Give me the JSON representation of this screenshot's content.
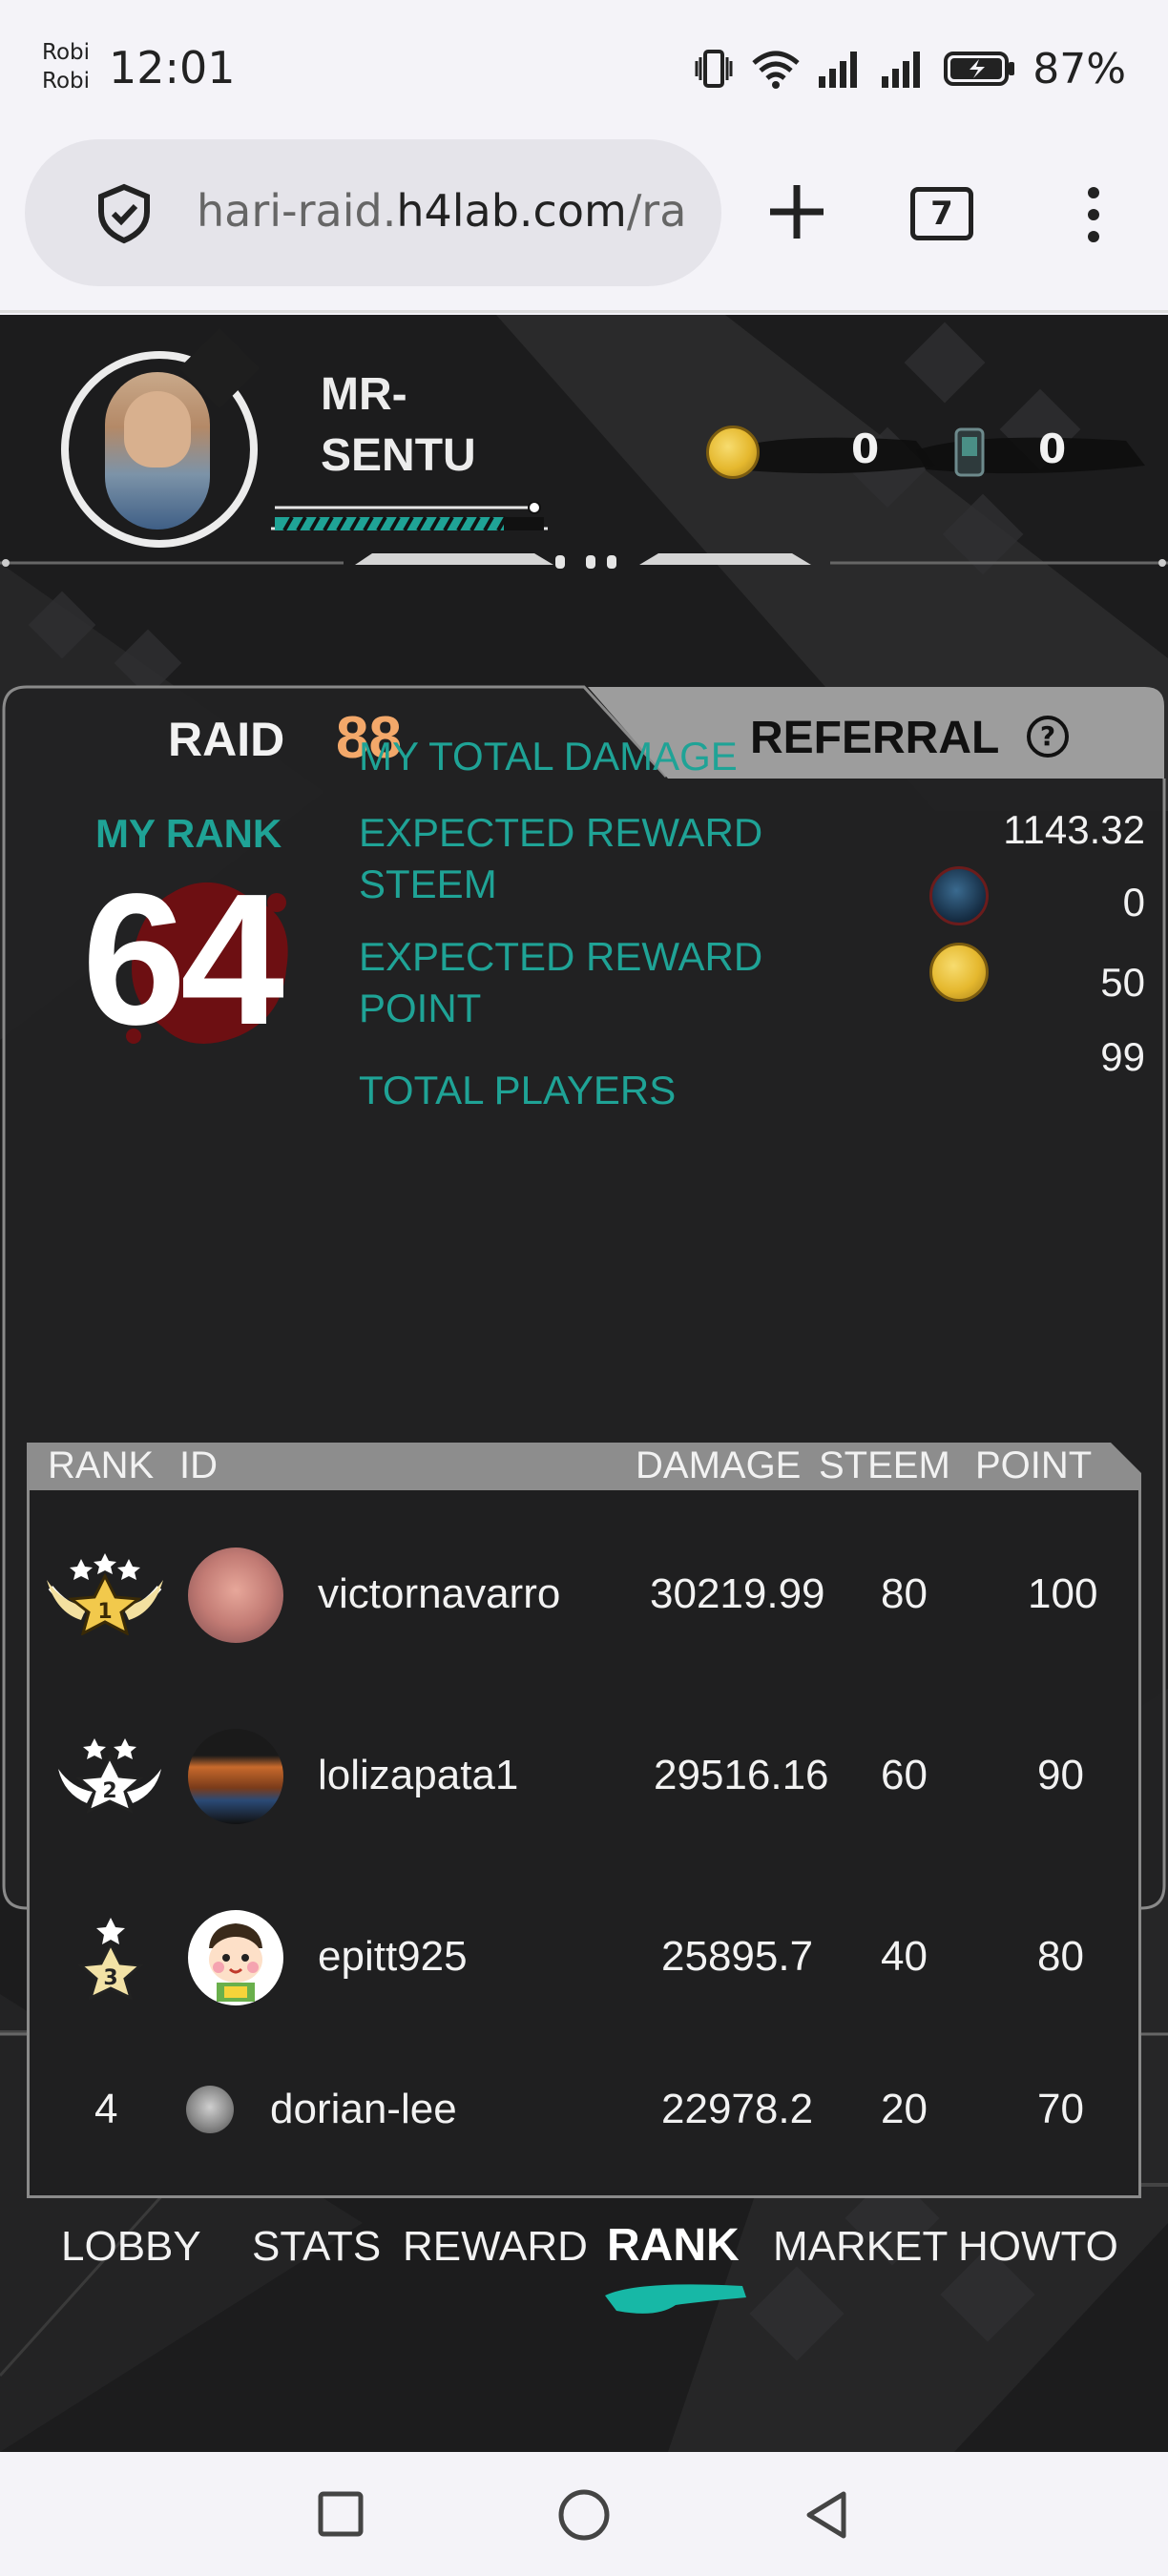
{
  "status_bar": {
    "carrier_1": "Robi",
    "carrier_2": "Robi",
    "time": "12:01",
    "battery": "87%"
  },
  "browser": {
    "url_prefix": "hari-raid.",
    "url_domain": "h4lab.com",
    "url_suffix": "/ra",
    "tab_count": "7"
  },
  "player": {
    "name": "MR-SENTU",
    "xp_progress": 0.85,
    "coin_value": "0",
    "item_value": "0"
  },
  "raid": {
    "label": "RAID",
    "number": "88",
    "referral_label": "REFERRAL",
    "help_label": "?"
  },
  "my_rank": {
    "label": "MY RANK",
    "value": "64"
  },
  "stats": [
    {
      "label": "MY TOTAL DAMAGE",
      "value": "1143.32"
    },
    {
      "label": "EXPECTED REWARD STEEM",
      "value": "0",
      "icon": "steem-icon"
    },
    {
      "label": "EXPECTED REWARD POINT",
      "value": "50",
      "icon": "coin-icon"
    },
    {
      "label": "TOTAL PLAYERS",
      "value": "99"
    }
  ],
  "leaderboard": {
    "headers": {
      "rank": "RANK",
      "id": "ID",
      "damage": "DAMAGE",
      "steem": "STEEM",
      "point": "POINT"
    },
    "rows": [
      {
        "rank": "1",
        "id": "victornavarro",
        "damage": "30219.99",
        "steem": "80",
        "point": "100"
      },
      {
        "rank": "2",
        "id": "lolizapata1",
        "damage": "29516.16",
        "steem": "60",
        "point": "90"
      },
      {
        "rank": "3",
        "id": "epitt925",
        "damage": "25895.7",
        "steem": "40",
        "point": "80"
      },
      {
        "rank": "4",
        "id": "dorian-lee",
        "damage": "22978.2",
        "steem": "20",
        "point": "70"
      }
    ]
  },
  "nav": {
    "items": [
      "LOBBY",
      "STATS",
      "REWARD",
      "RANK",
      "MARKET",
      "HOWTO"
    ],
    "active": "RANK"
  },
  "colors": {
    "accent_teal": "#1fa396",
    "raid_orange": "#f3a86a",
    "background": "#1c1c1d"
  }
}
